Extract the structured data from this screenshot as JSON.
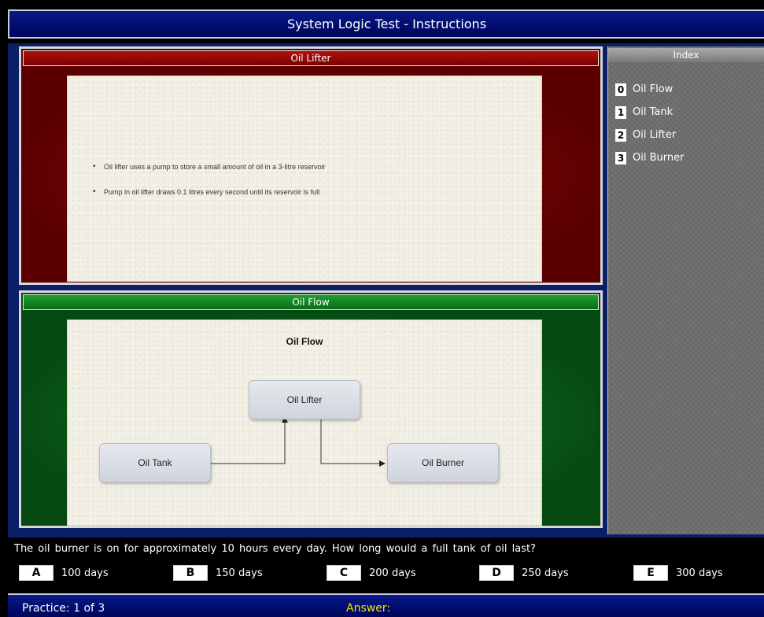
{
  "window": {
    "title": "System Logic Test - Instructions"
  },
  "red_panel": {
    "header": "Oil Lifter",
    "bullets": [
      "Oil lifter uses a pump to store a small amount of oil in a 3-litre reservoir",
      "Pump in oil lifter draws 0.1 litres every second until its reservoir is full"
    ]
  },
  "green_panel": {
    "header": "Oil Flow",
    "diagram": {
      "title": "Oil Flow",
      "nodes": {
        "tank": "Oil Tank",
        "lifter": "Oil Lifter",
        "burner": "Oil Burner"
      }
    }
  },
  "index": {
    "header": "Index",
    "items": [
      {
        "num": "0",
        "label": "Oil Flow"
      },
      {
        "num": "1",
        "label": "Oil Tank"
      },
      {
        "num": "2",
        "label": "Oil Lifter"
      },
      {
        "num": "3",
        "label": "Oil Burner"
      }
    ]
  },
  "question": {
    "text": "The oil burner is on for approximately 10 hours every day. How long would a full tank of oil last?",
    "options": [
      {
        "letter": "A",
        "text": "100 days"
      },
      {
        "letter": "B",
        "text": "150 days"
      },
      {
        "letter": "C",
        "text": "200 days"
      },
      {
        "letter": "D",
        "text": "250 days"
      },
      {
        "letter": "E",
        "text": "300 days"
      }
    ]
  },
  "status": {
    "practice": "Practice: 1 of 3",
    "answer_label": "Answer:"
  }
}
